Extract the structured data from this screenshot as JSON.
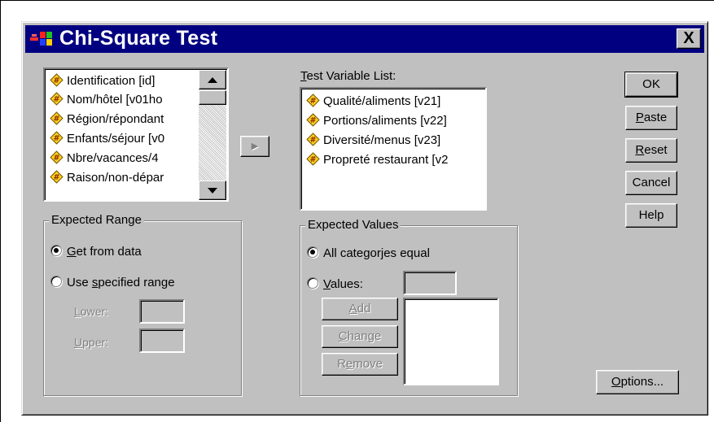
{
  "window": {
    "title": "Chi-Square Test",
    "close_label": "X"
  },
  "source_list": {
    "items": [
      "Identification [id]",
      "Nom/hôtel [v01ho",
      "Région/répondant",
      "Enfants/séjour [v0",
      "Nbre/vacances/4",
      "Raison/non-dépar"
    ]
  },
  "move_button": {
    "label": "▶"
  },
  "test_variable_list": {
    "label_prefix": "T",
    "label_rest": "est Variable List:",
    "items": [
      "Qualité/aliments [v21]",
      "Portions/aliments [v22]",
      "Diversité/menus [v23]",
      "Propreté restaurant [v2"
    ]
  },
  "buttons": {
    "ok": "OK",
    "paste_u": "P",
    "paste_rest": "aste",
    "reset_u": "R",
    "reset_rest": "eset",
    "cancel": "Cancel",
    "help": "Help",
    "options_u": "O",
    "options_rest": "ptions..."
  },
  "expected_range": {
    "legend": "Expected Range",
    "get_from_data_u": "G",
    "get_from_data_rest": "et from data",
    "use_specified_a": "Use ",
    "use_specified_u": "s",
    "use_specified_rest": "pecified range",
    "lower_u": "L",
    "lower_rest": "ower:",
    "upper_u": "U",
    "upper_rest": "pper:",
    "selected": "get_from_data"
  },
  "expected_values": {
    "legend": "Expected Values",
    "all_equal": "All categorjes equal",
    "values_u": "V",
    "values_rest": "alues:",
    "add_u": "A",
    "add_rest": "dd",
    "change_u": "C",
    "change_rest": "hange",
    "remove_a": "R",
    "remove_u": "e",
    "remove_rest": "move",
    "selected": "all_equal"
  }
}
